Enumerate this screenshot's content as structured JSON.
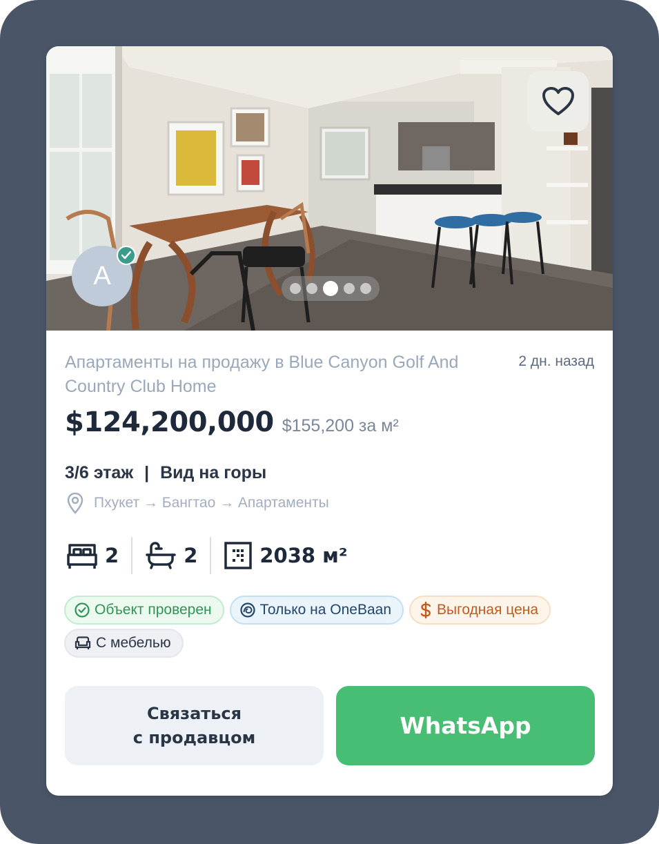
{
  "listing": {
    "title": "Апартаменты на продажу в Blue Canyon Golf And Country Club Home",
    "posted": "2 дн. назад",
    "price": "$124,200,000",
    "price_per_m2": "$155,200 за м²",
    "floor": "3/6 этаж",
    "separator": "|",
    "view": "Вид на горы",
    "location": "Пхукет → Бангтао → Апартаменты"
  },
  "specs": {
    "bedrooms": "2",
    "bathrooms": "2",
    "area": "2038 м²"
  },
  "badges": {
    "verified": "Объект проверен",
    "exclusive": "Только на OneBaan",
    "good_price": "Выгодная цена",
    "furnished": "С мебелью"
  },
  "seller": {
    "avatar_initial": "A"
  },
  "gallery": {
    "total_images": 5,
    "active_index": 2
  },
  "actions": {
    "contact_label": "Связаться\nс продавцом",
    "whatsapp_label": "WhatsApp"
  },
  "icons": {
    "favorite": "heart-icon",
    "verified": "check-icon",
    "location": "map-pin-icon",
    "bed": "bed-icon",
    "bath": "bathtub-icon",
    "area": "area-icon",
    "badge_verified": "check-circle-icon",
    "badge_exclusive": "onebaan-logo-icon",
    "badge_price": "dollar-icon",
    "badge_furnished": "sofa-icon"
  },
  "colors": {
    "frame": "#4a5568",
    "whatsapp": "#48bd74",
    "verified": "#3a9d8c"
  }
}
